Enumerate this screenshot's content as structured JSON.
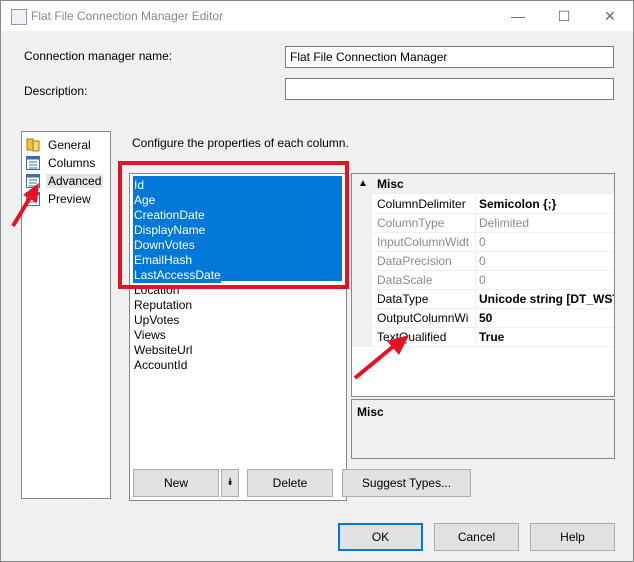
{
  "window": {
    "title": "Flat File Connection Manager Editor",
    "minimize_glyph": "—",
    "maximize_glyph": "☐",
    "close_glyph": "✕"
  },
  "form": {
    "connection_name_label": "Connection manager name:",
    "connection_name_value": "Flat File Connection Manager",
    "description_label": "Description:",
    "description_value": ""
  },
  "nav": {
    "items": [
      {
        "label": "General",
        "icon": "general-icon"
      },
      {
        "label": "Columns",
        "icon": "columns-icon"
      },
      {
        "label": "Advanced",
        "icon": "advanced-icon",
        "selected": true
      },
      {
        "label": "Preview",
        "icon": "preview-icon"
      }
    ]
  },
  "main": {
    "instruction": "Configure the properties of each column.",
    "columns": [
      {
        "name": "Id",
        "selected": true
      },
      {
        "name": "Age",
        "selected": true
      },
      {
        "name": "CreationDate",
        "selected": true
      },
      {
        "name": "DisplayName",
        "selected": true
      },
      {
        "name": "DownVotes",
        "selected": true
      },
      {
        "name": "EmailHash",
        "selected": true
      },
      {
        "name": "LastAccessDate",
        "selected": true
      },
      {
        "name": "Location",
        "selected": false
      },
      {
        "name": "Reputation",
        "selected": false
      },
      {
        "name": "UpVotes",
        "selected": false
      },
      {
        "name": "Views",
        "selected": false
      },
      {
        "name": "WebsiteUrl",
        "selected": false
      },
      {
        "name": "AccountId",
        "selected": false
      }
    ]
  },
  "properties": {
    "category": "Misc",
    "collapse_glyph": "▲",
    "rows": [
      {
        "name": "ColumnDelimiter",
        "value": "Semicolon {;}",
        "enabled": true,
        "bold": true
      },
      {
        "name": "ColumnType",
        "value": "Delimited",
        "enabled": false,
        "bold": false
      },
      {
        "name": "InputColumnWidt",
        "value": "0",
        "enabled": false,
        "bold": false
      },
      {
        "name": "DataPrecision",
        "value": "0",
        "enabled": false,
        "bold": false
      },
      {
        "name": "DataScale",
        "value": "0",
        "enabled": false,
        "bold": false
      },
      {
        "name": "DataType",
        "value": "Unicode string [DT_WST",
        "enabled": true,
        "bold": true
      },
      {
        "name": "OutputColumnWi",
        "value": "50",
        "enabled": true,
        "bold": true
      },
      {
        "name": "TextQualified",
        "value": "True",
        "enabled": true,
        "bold": true
      }
    ],
    "description_title": "Misc"
  },
  "buttons": {
    "new": "New",
    "dropdown_glyph": "⯯",
    "delete": "Delete",
    "suggest": "Suggest Types...",
    "ok": "OK",
    "cancel": "Cancel",
    "help": "Help"
  },
  "colors": {
    "selection": "#0078d7",
    "annotation": "#e81123"
  }
}
